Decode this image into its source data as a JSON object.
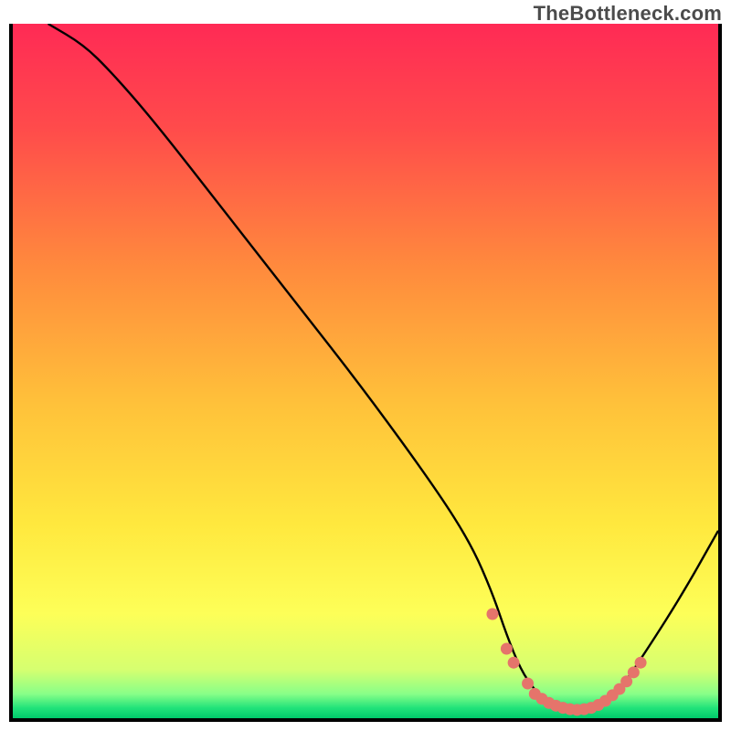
{
  "watermark": "TheBottleneck.com",
  "chart_data": {
    "type": "line",
    "title": "",
    "xlabel": "",
    "ylabel": "",
    "xlim": [
      0,
      100
    ],
    "ylim": [
      0,
      100
    ],
    "grid": false,
    "legend": false,
    "series": [
      {
        "name": "bottleneck-curve",
        "color": "#000000",
        "x": [
          5,
          10,
          14,
          20,
          30,
          40,
          50,
          60,
          65,
          68,
          70,
          72,
          74,
          76,
          78,
          80,
          82,
          84,
          86,
          90,
          95,
          100
        ],
        "y": [
          100,
          97,
          93,
          86,
          73,
          60,
          47,
          33,
          25,
          18,
          12,
          7,
          4,
          2,
          1,
          1,
          1,
          2,
          4,
          10,
          18,
          27
        ]
      }
    ],
    "markers": {
      "name": "optimal-zone-dots",
      "color": "#e5746b",
      "x": [
        68,
        70,
        71,
        73,
        74,
        75,
        76,
        77,
        78,
        79,
        80,
        81,
        82,
        83,
        84,
        85,
        86,
        87,
        88,
        89
      ],
      "y": [
        15,
        10,
        8,
        5,
        3.5,
        2.8,
        2.2,
        1.8,
        1.5,
        1.3,
        1.2,
        1.3,
        1.5,
        1.9,
        2.5,
        3.3,
        4.2,
        5.3,
        6.6,
        8.0
      ]
    },
    "background_gradient": {
      "stops": [
        {
          "offset": 0.0,
          "color": "#ff2a55"
        },
        {
          "offset": 0.15,
          "color": "#ff4b4b"
        },
        {
          "offset": 0.35,
          "color": "#ff8a3d"
        },
        {
          "offset": 0.55,
          "color": "#ffc23a"
        },
        {
          "offset": 0.72,
          "color": "#ffe83e"
        },
        {
          "offset": 0.85,
          "color": "#fdff58"
        },
        {
          "offset": 0.93,
          "color": "#d6ff70"
        },
        {
          "offset": 0.965,
          "color": "#88ff88"
        },
        {
          "offset": 0.985,
          "color": "#22e37a"
        },
        {
          "offset": 1.0,
          "color": "#00c96b"
        }
      ]
    }
  }
}
